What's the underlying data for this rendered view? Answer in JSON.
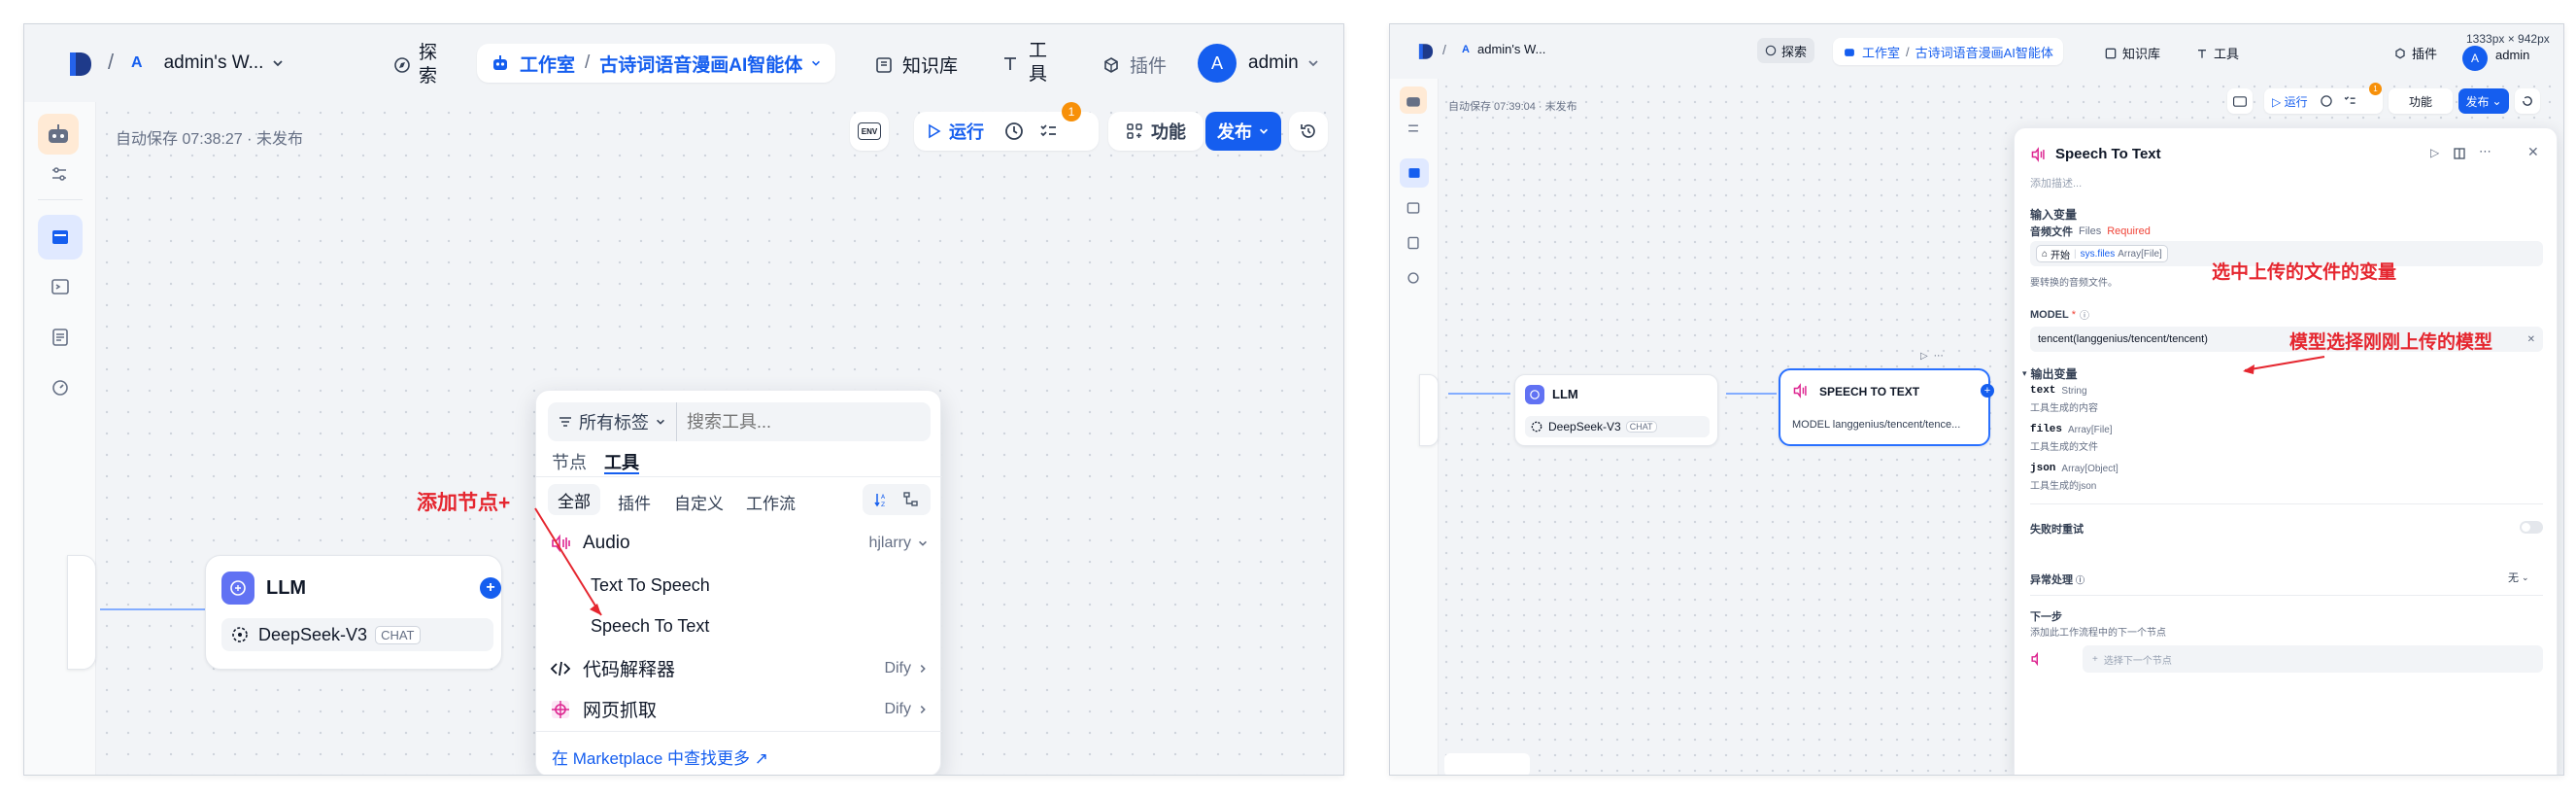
{
  "left": {
    "topbar": {
      "workspace": "admin's W...",
      "workspace_initial": "A",
      "explore": "探索",
      "studio": "工作室",
      "app_name": "古诗词语音漫画AI智能体",
      "knowledge": "知识库",
      "tools": "工具",
      "plugins": "插件",
      "user": "admin",
      "user_initial": "A"
    },
    "status": "自动保存 07:38:27 · 未发布",
    "toolbar": {
      "env": "ENV",
      "run": "运行",
      "checklist_badge": "1",
      "features": "功能",
      "publish": "发布"
    },
    "llm_node": {
      "title": "LLM",
      "model": "DeepSeek-V3",
      "badge": "CHAT"
    },
    "picker": {
      "filter": "所有标签",
      "search_placeholder": "搜索工具...",
      "tabs": [
        "节点",
        "工具"
      ],
      "subtabs": [
        "全部",
        "插件",
        "自定义",
        "工作流"
      ],
      "audio_group": "Audio",
      "audio_author": "hjlarry",
      "audio_items": [
        "Text To Speech",
        "Speech To Text"
      ],
      "code": "代码解释器",
      "code_author": "Dify",
      "crawler": "网页抓取",
      "crawler_author": "Dify",
      "marketplace": "在 Marketplace 中查找更多 ↗"
    },
    "annotation": "添加节点+"
  },
  "right": {
    "topbar": {
      "workspace": "admin's W...",
      "workspace_initial": "A",
      "explore": "探索",
      "studio": "工作室",
      "app_name": "古诗词语音漫画AI智能体",
      "knowledge": "知识库",
      "tools": "工具",
      "plugins": "插件",
      "user": "admin",
      "user_initial": "A",
      "size_label": "1333px × 942px"
    },
    "status": "自动保存 07:39:04 · 未发布",
    "toolbar": {
      "run": "运行",
      "checklist_badge": "1",
      "features": "功能",
      "publish": "发布"
    },
    "llm_node": {
      "title": "LLM",
      "model": "DeepSeek-V3",
      "badge": "CHAT"
    },
    "stt_node": {
      "title": "SPEECH TO TEXT",
      "model_line": "MODEL langgenius/tencent/tence..."
    },
    "side": {
      "title": "Speech To Text",
      "desc_placeholder": "添加描述...",
      "input_vars": "输入变量",
      "audio_file": "音频文件",
      "files_type": "Files",
      "required": "Required",
      "var_start": "开始",
      "var_name": "sys.files",
      "var_type": "Array[File]",
      "audio_hint": "要转换的音频文件。",
      "model_label": "MODEL",
      "model_value": "tencent(langgenius/tencent/tencent)",
      "output_vars": "输出变量",
      "outputs": [
        {
          "name": "text",
          "type": "String",
          "desc": "工具生成的内容"
        },
        {
          "name": "files",
          "type": "Array[File]",
          "desc": "工具生成的文件"
        },
        {
          "name": "json",
          "type": "Array[Object]",
          "desc": "工具生成的json"
        }
      ],
      "retry": "失败时重试",
      "error_handling": "异常处理",
      "error_value": "无",
      "next_step": "下一步",
      "next_hint": "添加此工作流程中的下一个节点",
      "select_next": "选择下一个节点"
    },
    "annotations": {
      "var": "选中上传的文件的变量",
      "model": "模型选择刚刚上传的模型"
    }
  },
  "colors": {
    "accent": "#155eef",
    "annotation": "#e5262f",
    "canvas": "#f2f4f7"
  }
}
